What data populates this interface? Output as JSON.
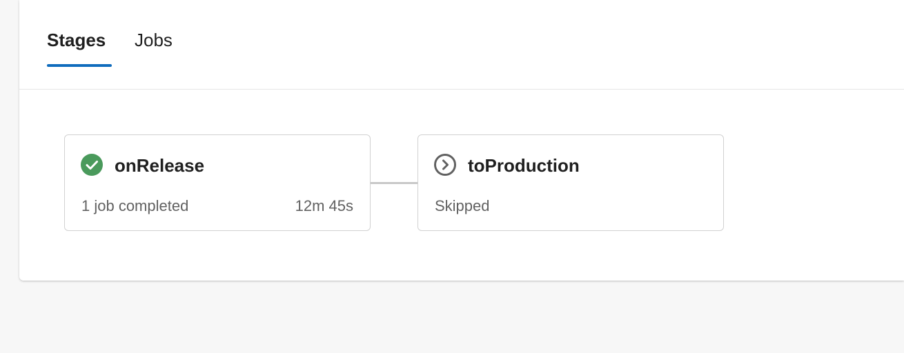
{
  "tabs": [
    {
      "label": "Stages",
      "selected": true
    },
    {
      "label": "Jobs",
      "selected": false
    }
  ],
  "colors": {
    "accent": "#0f6cbd",
    "success": "#4a9a5c",
    "skipped": "#616161"
  },
  "stages": [
    {
      "name": "onRelease",
      "status": "1 job completed",
      "duration": "12m 45s",
      "icon": "success-check-icon"
    },
    {
      "name": "toProduction",
      "status": "Skipped",
      "icon": "skipped-chevron-icon"
    }
  ]
}
